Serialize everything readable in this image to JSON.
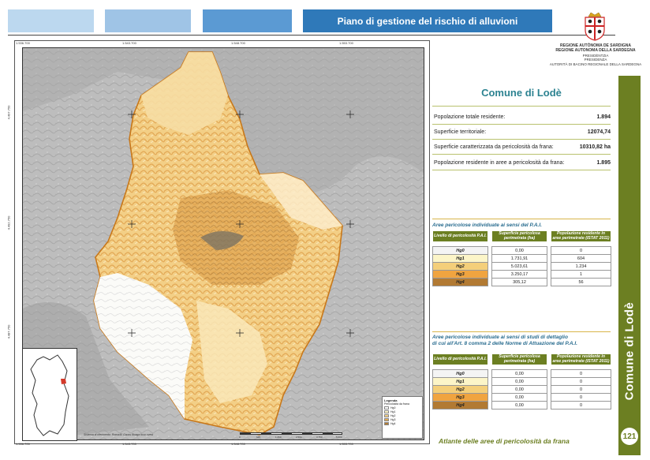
{
  "header": {
    "tabs": [
      {
        "color": "#bcd8ef"
      },
      {
        "color": "#9fc4e6"
      },
      {
        "color": "#5b9ad3"
      }
    ],
    "title": "Piano di gestione del rischio di alluvioni"
  },
  "institution": {
    "line1": "REGIONE AUTÒNOMA DE SARDIGNA",
    "line2": "REGIONE AUTONOMA DELLA SARDEGNA",
    "line3": "PRESIDÈNTZIA",
    "line4": "PRESIDENZA",
    "line5": "AUTORITÀ DI BACINO REGIONALE DELLA SARDEGNA"
  },
  "map": {
    "top_ticks": [
      "1.536.700",
      "1.543.700",
      "1.548.700",
      "1.553.700"
    ],
    "bottom_ticks": [
      "1.536.700",
      "1.543.700",
      "1.548.700",
      "1.553.700"
    ],
    "left_ticks": [
      "4.497.750",
      "4.492.750",
      "4.487.750"
    ],
    "credits": "Sistema di riferimento: Roma40 Gauss Boaga fuso ovest",
    "scale_labels": [
      "0",
      "625",
      "1.250",
      "2.500",
      "3.750",
      "5.000"
    ],
    "legend": {
      "title": "Legenda",
      "subtitle": "Pericolosità da frana",
      "items": [
        {
          "label": "Hg0",
          "color": "#ffffff"
        },
        {
          "label": "Hg1",
          "color": "#fbf3c6"
        },
        {
          "label": "Hg2",
          "color": "#f3cf86"
        },
        {
          "label": "Hg3",
          "color": "#e3aa52"
        },
        {
          "label": "Hg4",
          "color": "#b07c35"
        }
      ]
    }
  },
  "comune": {
    "title": "Comune di Lodè",
    "stats": [
      {
        "label": "Popolazione totale residente:",
        "value": "1.894"
      },
      {
        "label": "Superficie territoriale:",
        "value": "12074,74"
      },
      {
        "label": "Superficie caratterizzata da pericolosità da frana:",
        "value": "10310,82 ha"
      },
      {
        "label": "Popolazione residente in aree a pericolosità da frana:",
        "value": "1.895"
      }
    ]
  },
  "table1": {
    "title": "Aree pericolose individuate ai sensi del P.A.I.",
    "headers": [
      "Livello di pericolosità P.A.I.",
      "Superficie pericolosa perimetrata (ha)",
      "Popolazione residente in aree perimetrate (ISTAT 2011)"
    ],
    "rows": [
      {
        "cls": "Hg0",
        "area": "0,00",
        "pop": "0",
        "color": "#f4f4f4"
      },
      {
        "cls": "Hg1",
        "area": "1.731,91",
        "pop": "604",
        "color": "#fcf5c8"
      },
      {
        "cls": "Hg2",
        "area": "5.023,61",
        "pop": "1.234",
        "color": "#f4cf7a"
      },
      {
        "cls": "Hg3",
        "area": "3.250,17",
        "pop": "1",
        "color": "#f0a440"
      },
      {
        "cls": "Hg4",
        "area": "305,12",
        "pop": "56",
        "color": "#b27a33"
      }
    ]
  },
  "table2": {
    "title_line1": "Aree pericolose individuate ai sensi di studi di dettaglio",
    "title_line2": "di cui all'Art. 8 comma 2 delle Norme di Attuazione del P.A.I.",
    "headers": [
      "Livello di pericolosità P.A.I.",
      "Superficie pericolosa perimetrata (ha)",
      "Popolazione residente in aree perimetrate (ISTAT 2011)"
    ],
    "rows": [
      {
        "cls": "Hg0",
        "area": "0,00",
        "pop": "0",
        "color": "#f4f4f4"
      },
      {
        "cls": "Hg1",
        "area": "0,00",
        "pop": "0",
        "color": "#fcf5c8"
      },
      {
        "cls": "Hg2",
        "area": "0,00",
        "pop": "0",
        "color": "#f4cf7a"
      },
      {
        "cls": "Hg3",
        "area": "0,00",
        "pop": "0",
        "color": "#f0a440"
      },
      {
        "cls": "Hg4",
        "area": "0,00",
        "pop": "0",
        "color": "#b27a33"
      }
    ]
  },
  "sidebar": {
    "label": "Comune di Lodè",
    "page": "121",
    "color": "#6c7f22"
  },
  "footer": "Atlante delle aree di pericolosità da frana"
}
